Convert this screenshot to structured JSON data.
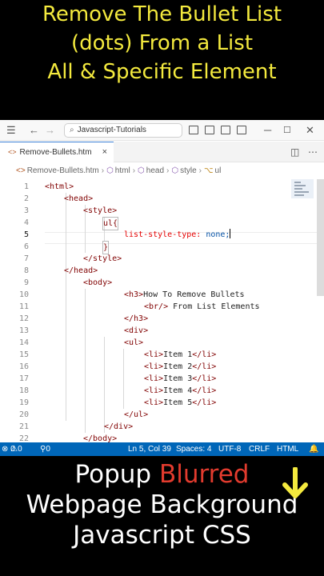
{
  "top_caption": {
    "lines": [
      "Remove The Bullet List",
      "(dots) From a List",
      "All & Specific Element"
    ],
    "color": "#f4ea3e"
  },
  "titlebar": {
    "search_text": "Javascript-Tutorials"
  },
  "tab": {
    "label": "Remove-Bullets.htm",
    "close_glyph": "×"
  },
  "breadcrumb": {
    "items": [
      "Remove-Bullets.htm",
      "html",
      "head",
      "style",
      "ul"
    ]
  },
  "code": {
    "active_line": 5,
    "lines": [
      {
        "n": "1",
        "text": "<html>"
      },
      {
        "n": "2",
        "text": "<head>"
      },
      {
        "n": "3",
        "text": "<style>"
      },
      {
        "n": "4",
        "text": "ul{"
      },
      {
        "n": "5",
        "prop": "list-style-type:",
        "value": " none;"
      },
      {
        "n": "6",
        "text": "}"
      },
      {
        "n": "7",
        "text": "</style>"
      },
      {
        "n": "8",
        "text": "</head>"
      },
      {
        "n": "9",
        "text": "<body>"
      },
      {
        "n": "10",
        "tag": "<h3>",
        "text": "How To Remove Bullets"
      },
      {
        "n": "11",
        "tag": "<br/>",
        "text": " From List Elements"
      },
      {
        "n": "12",
        "text": "</h3>"
      },
      {
        "n": "13",
        "text": "<div>"
      },
      {
        "n": "14",
        "text": "<ul>"
      },
      {
        "n": "15",
        "tag": "<li>",
        "text": "Item 1",
        "close": "</li>"
      },
      {
        "n": "16",
        "tag": "<li>",
        "text": "Item 2",
        "close": "</li>"
      },
      {
        "n": "17",
        "tag": "<li>",
        "text": "Item 3",
        "close": "</li>"
      },
      {
        "n": "18",
        "tag": "<li>",
        "text": "Item 4",
        "close": "</li>"
      },
      {
        "n": "19",
        "tag": "<li>",
        "text": "Item 5",
        "close": "</li>"
      },
      {
        "n": "20",
        "text": "</ul>"
      },
      {
        "n": "21",
        "text": "</div>"
      },
      {
        "n": "22",
        "text": "</body>"
      }
    ]
  },
  "statusbar": {
    "errors": "0",
    "warnings": "0",
    "ports": "0",
    "position": "Ln 5, Col 39",
    "spaces": "Spaces: 4",
    "encoding": "UTF-8",
    "eol": "CRLF",
    "language": "HTML",
    "background": "#0066b8"
  },
  "bottom_caption": {
    "line1_a": "Popup ",
    "line1_b": "Blurred",
    "line2": "Webpage Background",
    "line3": "Javascript CSS",
    "highlight_color": "#e23b2e",
    "arrow_icon": "down-arrow-icon"
  }
}
